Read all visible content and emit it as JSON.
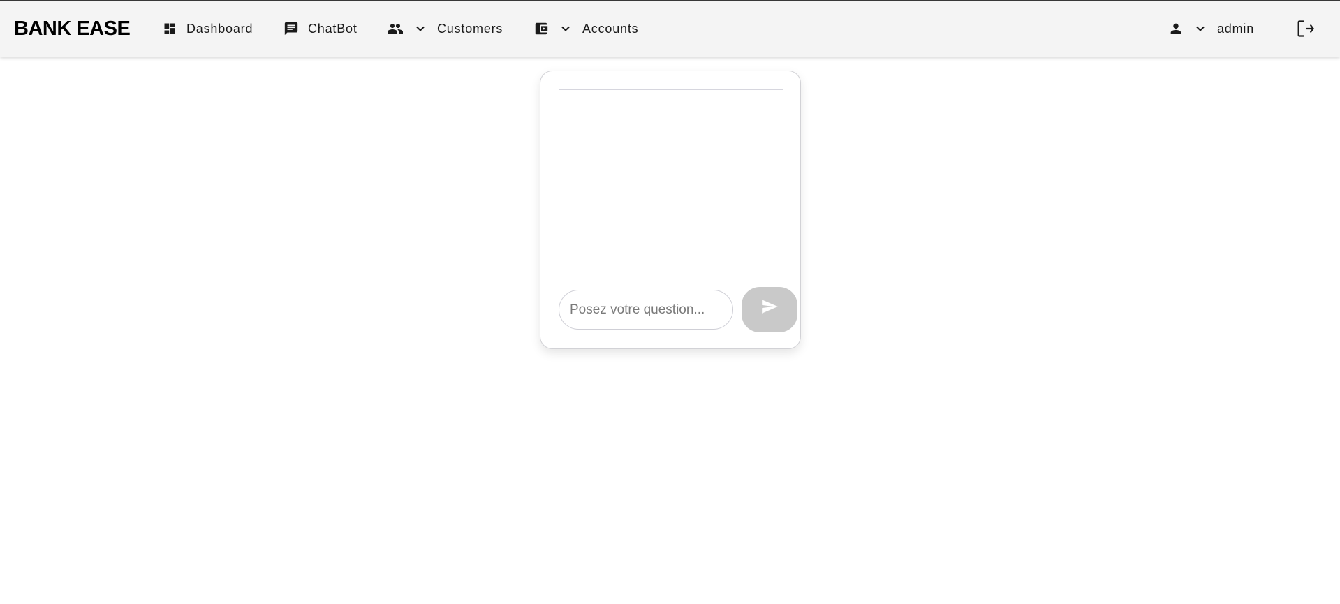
{
  "app": {
    "brand": "BANK EASE"
  },
  "nav": {
    "dashboard": {
      "label": "Dashboard",
      "icon": "dashboard-icon"
    },
    "chatbot": {
      "label": "ChatBot",
      "icon": "chat-icon"
    },
    "customers": {
      "label": "Customers",
      "icon": "people-icon",
      "dropdown_icon": "chevron-down-icon"
    },
    "accounts": {
      "label": "Accounts",
      "icon": "wallet-icon",
      "dropdown_icon": "chevron-down-icon"
    }
  },
  "user": {
    "name": "admin",
    "icon": "person-icon",
    "dropdown_icon": "chevron-down-icon"
  },
  "logout": {
    "icon": "logout-icon"
  },
  "chat": {
    "input_placeholder": "Posez votre question...",
    "input_value": "",
    "send_icon": "send-icon"
  },
  "colors": {
    "navbar_bg": "#f4f4f4",
    "send_button_bg": "#c9c9c9",
    "text": "#1a1a1a"
  }
}
